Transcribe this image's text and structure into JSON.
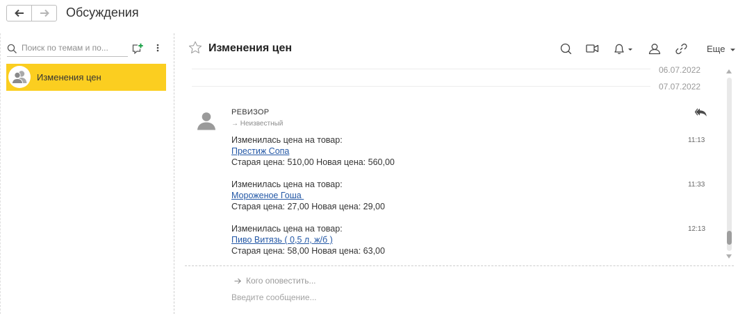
{
  "window": {
    "title": "Обсуждения"
  },
  "sidebar": {
    "search_placeholder": "Поиск по темам и по...",
    "topics": [
      {
        "label": "Изменения цен",
        "selected": true
      }
    ]
  },
  "conversation": {
    "title": "Изменения цен",
    "more_label": "Еще",
    "dates": [
      "06.07.2022",
      "07.07.2022"
    ],
    "author": "РЕВИЗОР",
    "recipient": "→ Неизвестный",
    "messages": [
      {
        "intro": "Изменилась цена на товар:",
        "product": "Престиж Сопа",
        "prices": "Старая цена: 510,00 Новая цена: 560,00",
        "time": "11:13"
      },
      {
        "intro": "Изменилась цена на товар:",
        "product": "Мороженое Гоша ",
        "prices": "Старая цена: 27,00 Новая цена: 29,00",
        "time": "11:33"
      },
      {
        "intro": "Изменилась цена на товар:",
        "product": "Пиво Витязь ( 0,5 л, ж/б )",
        "prices": "Старая цена: 58,00 Новая цена: 63,00",
        "time": "12:13"
      }
    ]
  },
  "composer": {
    "notify_placeholder": "Кого оповестить...",
    "message_placeholder": "Введите сообщение..."
  },
  "scroll": {
    "position": 0.96,
    "visible_fraction": 0.08
  },
  "colors": {
    "selected_topic": "#fbce20",
    "link": "#2458a6",
    "add_icon_plus": "#1ea24a"
  },
  "icons": [
    "back-arrow-icon",
    "forward-arrow-icon",
    "search-icon",
    "new-topic-icon",
    "kebab-menu-icon",
    "group-avatar-icon",
    "star-icon",
    "search-icon",
    "video-icon",
    "bell-icon",
    "participants-icon",
    "link-icon",
    "user-avatar-icon",
    "reply-icon",
    "right-arrow-icon"
  ]
}
